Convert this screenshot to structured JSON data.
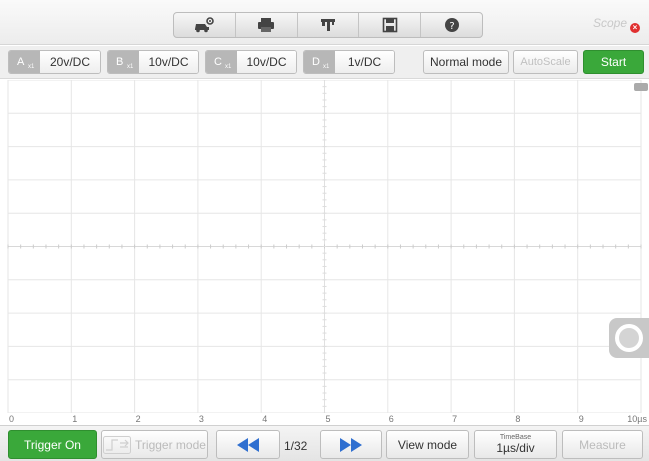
{
  "toolbar": {
    "tools": [
      {
        "name": "vehicle-settings-icon"
      },
      {
        "name": "print-icon"
      },
      {
        "name": "probe-icon"
      },
      {
        "name": "save-icon"
      },
      {
        "name": "help-icon"
      }
    ],
    "brand": "Scope"
  },
  "channels": [
    {
      "letter": "A",
      "mult": "x1",
      "value": "20v/DC"
    },
    {
      "letter": "B",
      "mult": "x1",
      "value": "10v/DC"
    },
    {
      "letter": "C",
      "mult": "x1",
      "value": "10v/DC"
    },
    {
      "letter": "D",
      "mult": "x1",
      "value": "1v/DC"
    }
  ],
  "controls": {
    "normal_mode": "Normal mode",
    "autoscale": "AutoScale",
    "start": "Start"
  },
  "plot": {
    "x_ticks": [
      "0",
      "1",
      "2",
      "3",
      "4",
      "5",
      "6",
      "7",
      "8",
      "9",
      "10µs"
    ],
    "grid_cols": 10,
    "grid_rows": 10
  },
  "bottom": {
    "trigger_on": "Trigger On",
    "trigger_mode": "Trigger mode",
    "page": "1/32",
    "view_mode": "View mode",
    "timebase_caption": "TimeBase",
    "timebase_value": "1µs/div",
    "measure": "Measure"
  },
  "colors": {
    "accent_green": "#3aa83a",
    "nav_blue": "#2f6fd0",
    "channel_tag": "#b7b7b7"
  }
}
